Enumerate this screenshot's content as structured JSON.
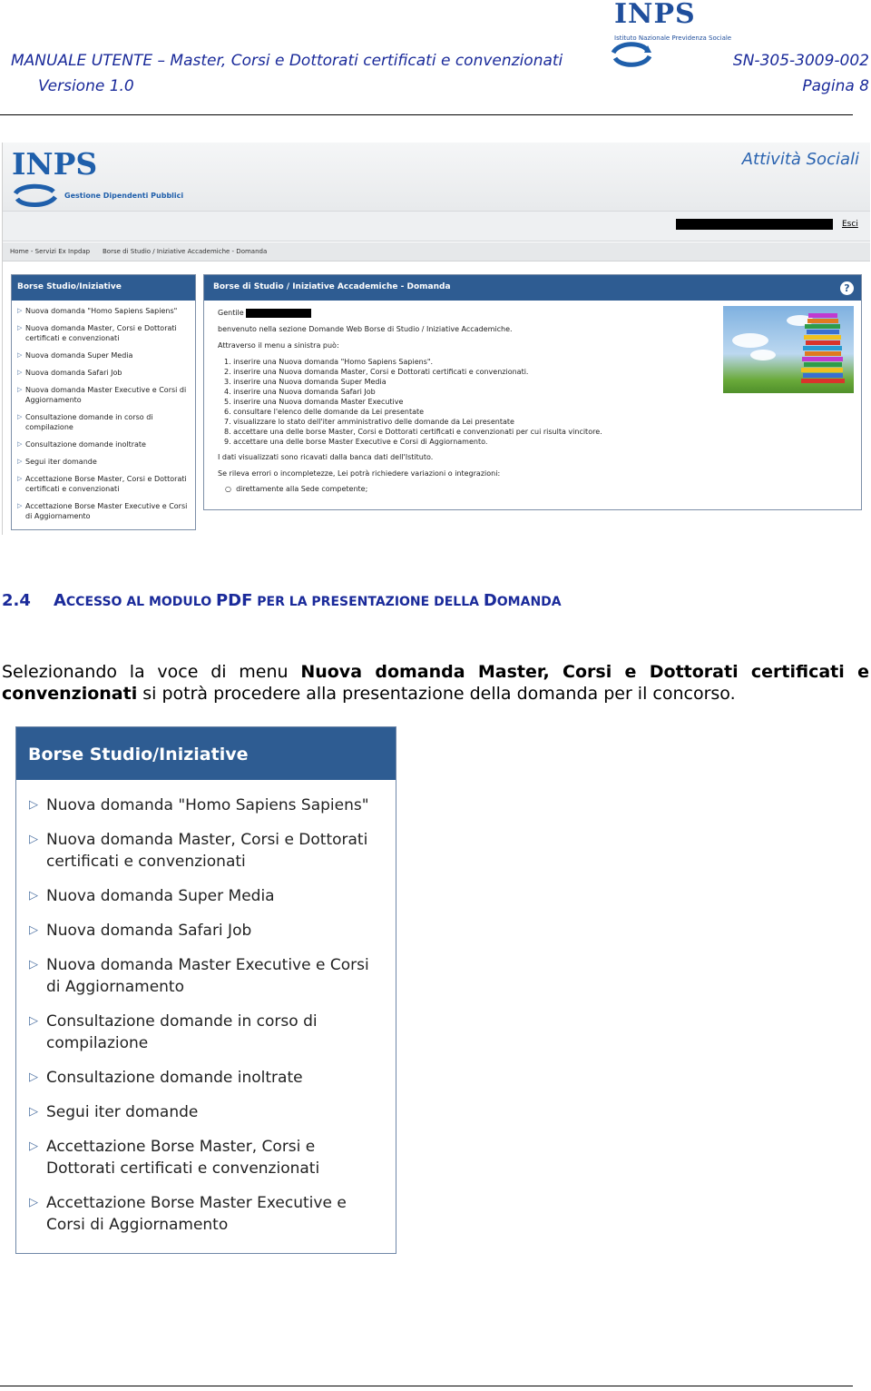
{
  "doc_header": {
    "title": "MANUALE UTENTE – Master, Corsi e Dottorati certificati e convenzionati",
    "code": "SN-305-3009-002",
    "version": "Versione 1.0",
    "page": "Pagina 8",
    "logo_text": "INPS",
    "logo_sub": "Istituto Nazionale Previdenza Sociale"
  },
  "screenshot1": {
    "logo_text": "INPS",
    "logo_sub": "Gestione Dipendenti Pubblici",
    "section_title": "Attività Sociali",
    "exit_link": "Esci",
    "breadcrumb": [
      "Home - Servizi Ex Inpdap",
      "Borse di Studio / Iniziative Accademiche - Domanda"
    ],
    "left_panel": {
      "title": "Borse Studio/Iniziative",
      "items": [
        "Nuova domanda \"Homo Sapiens Sapiens\"",
        "Nuova domanda Master, Corsi e Dottorati certificati e convenzionati",
        "Nuova domanda Super Media",
        "Nuova domanda Safari Job",
        "Nuova domanda Master Executive e Corsi di Aggiornamento",
        "Consultazione domande in corso di compilazione",
        "Consultazione domande inoltrate",
        "Segui iter domande",
        "Accettazione Borse Master, Corsi e Dottorati certificati e convenzionati",
        "Accettazione Borse Master Executive e Corsi di Aggiornamento"
      ]
    },
    "main_panel": {
      "title": "Borse di Studio / Iniziative Accademiche - Domanda",
      "greeting": "Gentile",
      "welcome": "benvenuto nella sezione Domande Web Borse di Studio / Iniziative Accademiche.",
      "intro": "Attraverso il menu a sinistra può:",
      "steps": [
        "1. inserire una Nuova domanda \"Homo Sapiens Sapiens\".",
        "2. inserire una Nuova domanda Master, Corsi e Dottorati certificati e convenzionati.",
        "3. inserire una Nuova domanda Super Media",
        "4. inserire una Nuova domanda Safari Job",
        "5. inserire una Nuova domanda Master Executive",
        "6. consultare l'elenco delle domande da Lei presentate",
        "7. visualizzare lo stato dell'iter amministrativo delle domande da Lei presentate",
        "8. accettare una delle borse Master, Corsi e Dottorati certificati e convenzionati per cui risulta vincitore.",
        "9. accettare una delle borse Master Executive e Corsi di Aggiornamento."
      ],
      "data_note": "I dati visualizzati sono ricavati dalla banca dati dell'Istituto.",
      "errors_note": "Se rileva errori o incompletezze, Lei potrà richiedere variazioni o integrazioni:",
      "option": "direttamente alla Sede competente;"
    }
  },
  "section": {
    "number": "2.4",
    "title_parts": [
      "A",
      "CCESSO AL MODULO ",
      "PDF",
      " PER LA PRESENTAZIONE DELLA ",
      "D",
      "OMANDA"
    ]
  },
  "paragraph": {
    "pre": "Selezionando la voce di menu ",
    "bold": "Nuova domanda Master, Corsi e Dottorati certificati e convenzionati",
    "post": " si potrà procedere alla presentazione della domanda per il concorso."
  },
  "screenshot2": {
    "title": "Borse Studio/Iniziative",
    "items": [
      "Nuova domanda \"Homo Sapiens Sapiens\"",
      "Nuova domanda Master, Corsi e Dottorati certificati e convenzionati",
      "Nuova domanda Super Media",
      "Nuova domanda Safari Job",
      "Nuova domanda Master Executive e Corsi di Aggiornamento",
      "Consultazione domande in corso di compilazione",
      "Consultazione domande inoltrate",
      "Segui iter domande",
      "Accettazione Borse Master, Corsi e Dottorati certificati e convenzionati",
      "Accettazione Borse Master Executive e Corsi di Aggiornamento"
    ]
  },
  "colors": {
    "header_text": "#1a2a9a",
    "panel_header": "#2e5c92",
    "accent": "#2a63b0"
  }
}
